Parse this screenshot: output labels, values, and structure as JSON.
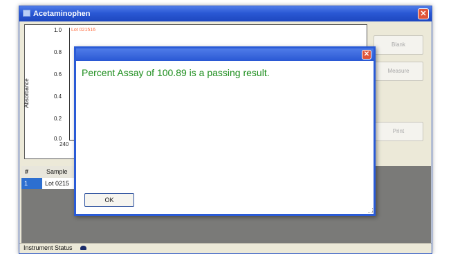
{
  "window": {
    "title": "Acetaminophen",
    "icon": "window-app-icon",
    "close_label": "✕"
  },
  "plot": {
    "y_axis_label": "Absorbance",
    "y_ticks": [
      "1.0",
      "0.8",
      "0.6",
      "0.4",
      "0.2",
      "0.0"
    ],
    "x_tick": "240",
    "legend_ref": "Lot 021516"
  },
  "side_buttons": {
    "blank": "Blank",
    "measure": "Measure",
    "print": "Print"
  },
  "table": {
    "headers": [
      "#",
      "Sample"
    ],
    "rows": [
      {
        "num": "1",
        "sample": "Lot 0215"
      }
    ]
  },
  "status_bar": {
    "label": "Instrument Status"
  },
  "dialog": {
    "message": "Percent Assay of 100.89 is a passing result.",
    "ok_label": "OK",
    "close_label": "✕"
  },
  "colors": {
    "title_blue": "#2a58d4",
    "message_green": "#1a8c1a",
    "close_red": "#e0553a"
  }
}
